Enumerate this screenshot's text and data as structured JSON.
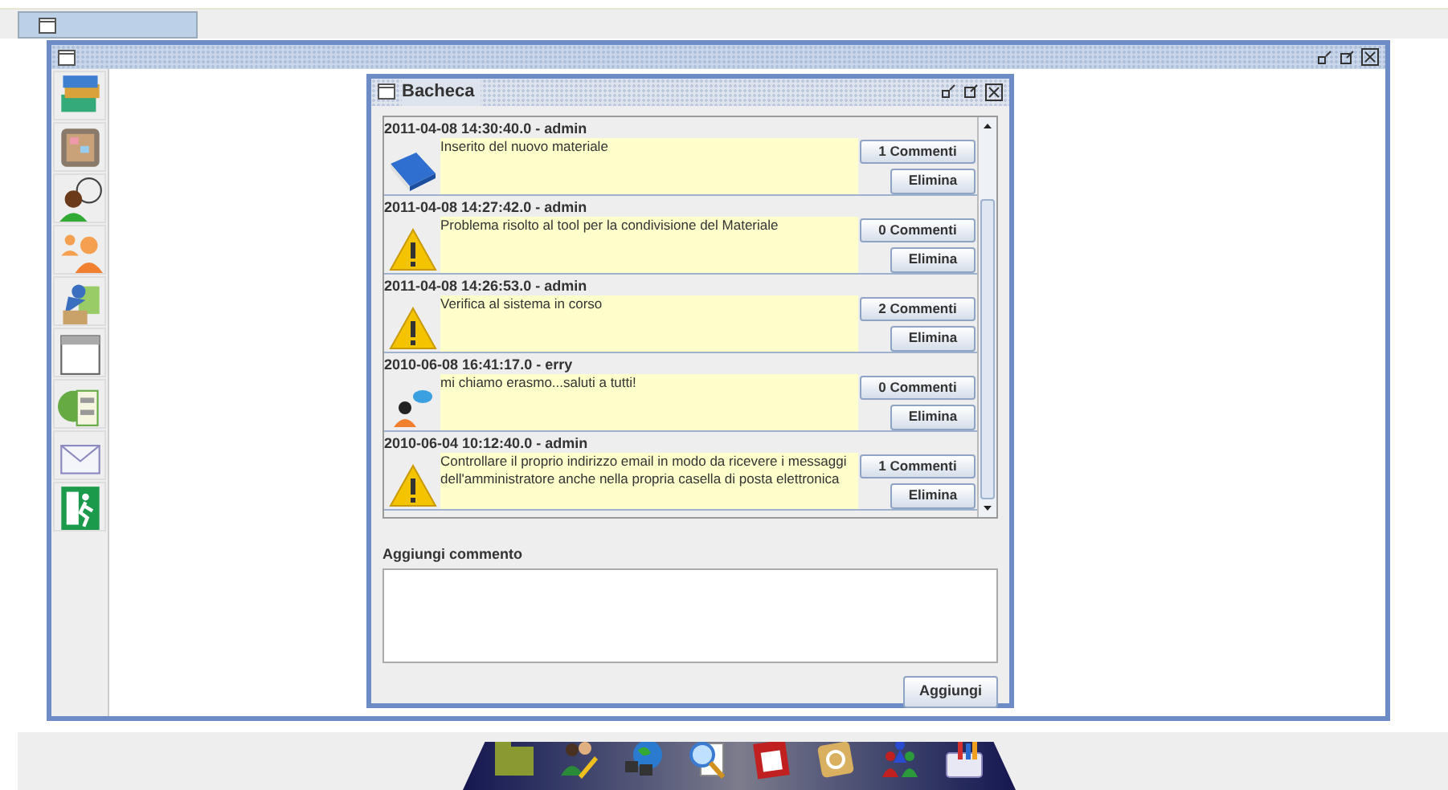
{
  "inner_window": {
    "title": "Bacheca"
  },
  "posts": [
    {
      "header": "2011-04-08 14:30:40.0 - admin",
      "kind": "book",
      "text": "Inserito del nuovo materiale",
      "comments_button": "1 Commenti",
      "delete_button": "Elimina"
    },
    {
      "header": "2011-04-08 14:27:42.0 - admin",
      "kind": "warning",
      "text": "Problema risolto al tool per la condivisione del Materiale",
      "comments_button": "0 Commenti",
      "delete_button": "Elimina"
    },
    {
      "header": "2011-04-08 14:26:53.0 - admin",
      "kind": "warning",
      "text": "Verifica al sistema in corso",
      "comments_button": "2 Commenti",
      "delete_button": "Elimina"
    },
    {
      "header": "2010-06-08 16:41:17.0 - erry",
      "kind": "user",
      "text": "mi chiamo erasmo...saluti a tutti!",
      "comments_button": "0 Commenti",
      "delete_button": "Elimina"
    },
    {
      "header": "2010-06-04 10:12:40.0 - admin",
      "kind": "warning",
      "text": "Controllare il proprio indirizzo email in modo da ricevere i messaggi dell'amministratore anche nella propria casella di posta elettronica",
      "comments_button": "1 Commenti",
      "delete_button": "Elimina"
    }
  ],
  "comment_form": {
    "label": "Aggiungi commento",
    "submit_button": "Aggiungi"
  }
}
